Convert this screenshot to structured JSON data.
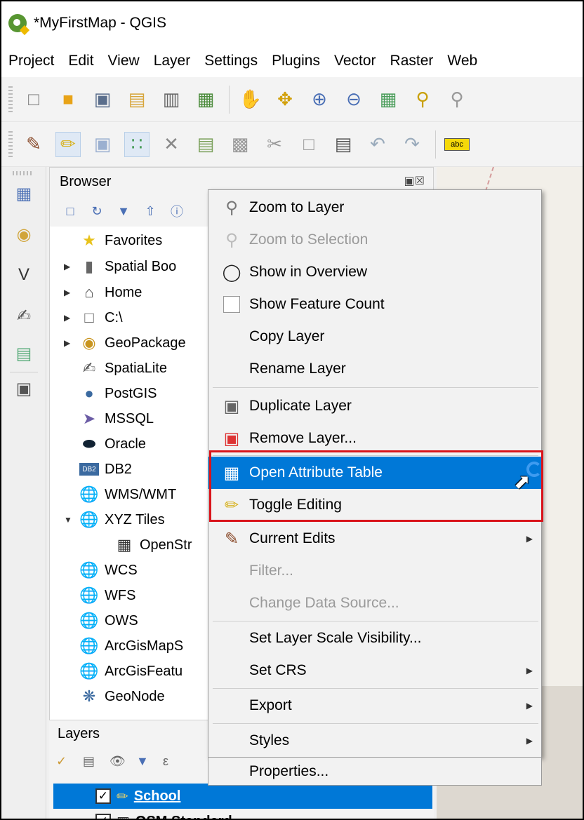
{
  "window": {
    "title": "*MyFirstMap - QGIS",
    "logo_icon": "qgis-logo-icon"
  },
  "menubar": [
    "Project",
    "Edit",
    "View",
    "Layer",
    "Settings",
    "Plugins",
    "Vector",
    "Raster",
    "Web"
  ],
  "toolbar1": [
    "new-project-icon",
    "open-project-icon",
    "save-project-icon",
    "new-print-layout-icon",
    "layout-manager-icon",
    "style-manager-icon",
    "pan-icon",
    "pan-to-selection-icon",
    "zoom-in-icon",
    "zoom-out-icon",
    "zoom-full-icon",
    "zoom-to-selection-icon",
    "zoom-to-layer-icon",
    "zoom-native-icon"
  ],
  "toolbar2": [
    "current-edits-icon",
    "toggle-editing-icon",
    "save-edits-icon",
    "digitize-icon",
    "vertex-tool-icon",
    "modify-attributes-icon",
    "delete-selected-icon",
    "cut-features-icon",
    "copy-features-icon",
    "paste-features-icon",
    "undo-icon",
    "redo-icon",
    "label-icon"
  ],
  "browser": {
    "title": "Browser",
    "items": [
      {
        "label": "Favorites",
        "icon": "star-icon",
        "arrow": ""
      },
      {
        "label": "Spatial Boo",
        "icon": "bookmark-icon",
        "arrow": "▶"
      },
      {
        "label": "Home",
        "icon": "home-icon",
        "arrow": "▶"
      },
      {
        "label": "C:\\",
        "icon": "drive-icon",
        "arrow": "▶"
      },
      {
        "label": "GeoPackage",
        "icon": "geopackage-icon",
        "arrow": "▶"
      },
      {
        "label": "SpatiaLite",
        "icon": "spatialite-icon",
        "arrow": ""
      },
      {
        "label": "PostGIS",
        "icon": "postgis-icon",
        "arrow": ""
      },
      {
        "label": "MSSQL",
        "icon": "mssql-icon",
        "arrow": ""
      },
      {
        "label": "Oracle",
        "icon": "oracle-icon",
        "arrow": ""
      },
      {
        "label": "DB2",
        "icon": "db2-icon",
        "arrow": ""
      },
      {
        "label": "WMS/WMT",
        "icon": "wms-icon",
        "arrow": ""
      },
      {
        "label": "XYZ Tiles",
        "icon": "xyz-icon",
        "arrow": "▼"
      },
      {
        "label": "OpenStr",
        "icon": "tile-icon",
        "arrow": ""
      },
      {
        "label": "WCS",
        "icon": "wcs-icon",
        "arrow": ""
      },
      {
        "label": "WFS",
        "icon": "wfs-icon",
        "arrow": ""
      },
      {
        "label": "OWS",
        "icon": "ows-icon",
        "arrow": ""
      },
      {
        "label": "ArcGisMapS",
        "icon": "arcgis-map-icon",
        "arrow": ""
      },
      {
        "label": "ArcGisFeatu",
        "icon": "arcgis-feature-icon",
        "arrow": ""
      },
      {
        "label": "GeoNode",
        "icon": "geonode-icon",
        "arrow": ""
      }
    ]
  },
  "layers": {
    "title": "Layers",
    "rows": [
      {
        "label": "School",
        "checked": "✓"
      },
      {
        "label": "OSM Standard",
        "checked": "✓"
      }
    ]
  },
  "context_menu": {
    "items": [
      {
        "label": "Zoom to Layer",
        "icon": "zoom-to-layer-icon",
        "state": "normal"
      },
      {
        "label": "Zoom to Selection",
        "icon": "zoom-to-selection-icon",
        "state": "disabled"
      },
      {
        "label": "Show in Overview",
        "icon": "overview-icon",
        "state": "normal"
      },
      {
        "label": "Show Feature Count",
        "icon": "checkbox-icon",
        "state": "normal"
      },
      {
        "label": "Copy Layer",
        "icon": "",
        "state": "normal"
      },
      {
        "label": "Rename Layer",
        "icon": "",
        "state": "normal"
      },
      {
        "label": "Duplicate Layer",
        "icon": "duplicate-layer-icon",
        "state": "normal"
      },
      {
        "label": "Remove Layer...",
        "icon": "remove-layer-icon",
        "state": "normal"
      },
      {
        "label": "Open Attribute Table",
        "icon": "attribute-table-icon",
        "state": "highlighted"
      },
      {
        "label": "Toggle Editing",
        "icon": "toggle-editing-icon",
        "state": "normal"
      },
      {
        "label": "Current Edits",
        "icon": "current-edits-icon",
        "state": "normal",
        "submenu": "▶"
      },
      {
        "label": "Filter...",
        "icon": "",
        "state": "disabled"
      },
      {
        "label": "Change Data Source...",
        "icon": "",
        "state": "disabled"
      },
      {
        "label": "Set Layer Scale Visibility...",
        "icon": "",
        "state": "normal"
      },
      {
        "label": "Set CRS",
        "icon": "",
        "state": "normal",
        "submenu": "▶"
      },
      {
        "label": "Export",
        "icon": "",
        "state": "normal",
        "submenu": "▶"
      },
      {
        "label": "Styles",
        "icon": "",
        "state": "normal",
        "submenu": "▶"
      },
      {
        "label": "Properties...",
        "icon": "",
        "state": "normal"
      }
    ]
  },
  "colors": {
    "highlight": "#0078d7",
    "annotation_box": "#d9141b"
  }
}
